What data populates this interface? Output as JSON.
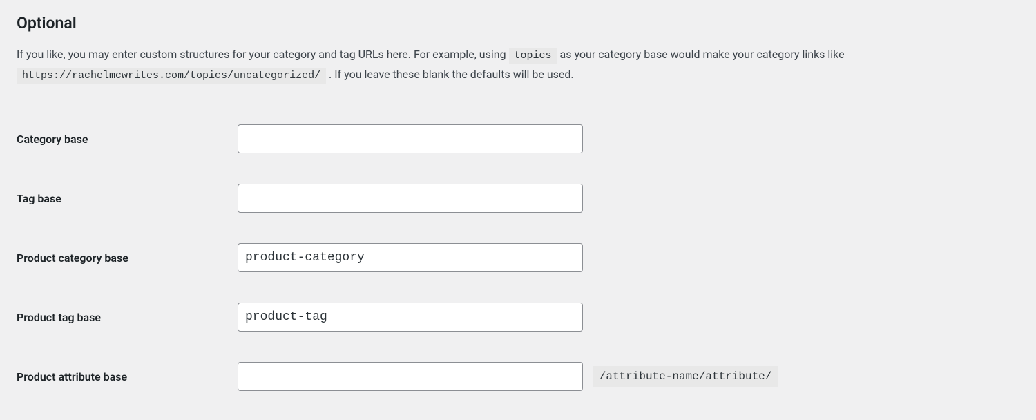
{
  "heading": "Optional",
  "description": {
    "part1": "If you like, you may enter custom structures for your category and tag URLs here. For example, using ",
    "code1": "topics",
    "part2": " as your category base would make your category links like ",
    "code2": "https://rachelmcwrites.com/topics/uncategorized/",
    "part3": " . If you leave these blank the defaults will be used."
  },
  "fields": {
    "category_base": {
      "label": "Category base",
      "value": ""
    },
    "tag_base": {
      "label": "Tag base",
      "value": ""
    },
    "product_category_base": {
      "label": "Product category base",
      "value": "product-category"
    },
    "product_tag_base": {
      "label": "Product tag base",
      "value": "product-tag"
    },
    "product_attribute_base": {
      "label": "Product attribute base",
      "value": "",
      "suffix": "/attribute-name/attribute/"
    }
  }
}
